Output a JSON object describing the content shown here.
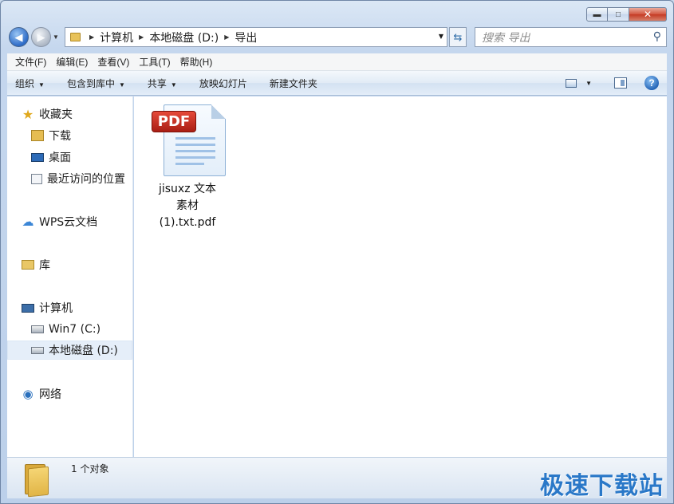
{
  "window": {
    "caption_buttons": {
      "minimize": "▬",
      "maximize": "□",
      "close": "✕"
    }
  },
  "nav": {
    "back_glyph": "◀",
    "forward_glyph": "▶",
    "breadcrumb": [
      "计算机",
      "本地磁盘 (D:)",
      "导出"
    ],
    "refresh_glyph": "⇆",
    "search_placeholder": "搜索 导出"
  },
  "menubar": {
    "items": [
      "文件(F)",
      "编辑(E)",
      "查看(V)",
      "工具(T)",
      "帮助(H)"
    ]
  },
  "toolbar": {
    "items": [
      {
        "label": "组织",
        "dropdown": true
      },
      {
        "label": "包含到库中",
        "dropdown": true
      },
      {
        "label": "共享",
        "dropdown": true
      },
      {
        "label": "放映幻灯片",
        "dropdown": false
      },
      {
        "label": "新建文件夹",
        "dropdown": false
      }
    ],
    "help_glyph": "?"
  },
  "sidebar": {
    "favorites": {
      "label": "收藏夹",
      "items": [
        "下载",
        "桌面",
        "最近访问的位置"
      ]
    },
    "wps": {
      "label": "WPS云文档"
    },
    "libraries": {
      "label": "库"
    },
    "computer": {
      "label": "计算机",
      "items": [
        "Win7 (C:)",
        "本地磁盘 (D:)"
      ],
      "selected": "本地磁盘 (D:)"
    },
    "network": {
      "label": "网络"
    }
  },
  "files": [
    {
      "badge": "PDF",
      "name_lines": [
        "jisuxz 文本",
        "素材",
        "(1).txt.pdf"
      ],
      "icon": "pdf-file-icon"
    }
  ],
  "status": {
    "count_text": "1 个对象",
    "watermark": "极速下载站"
  }
}
